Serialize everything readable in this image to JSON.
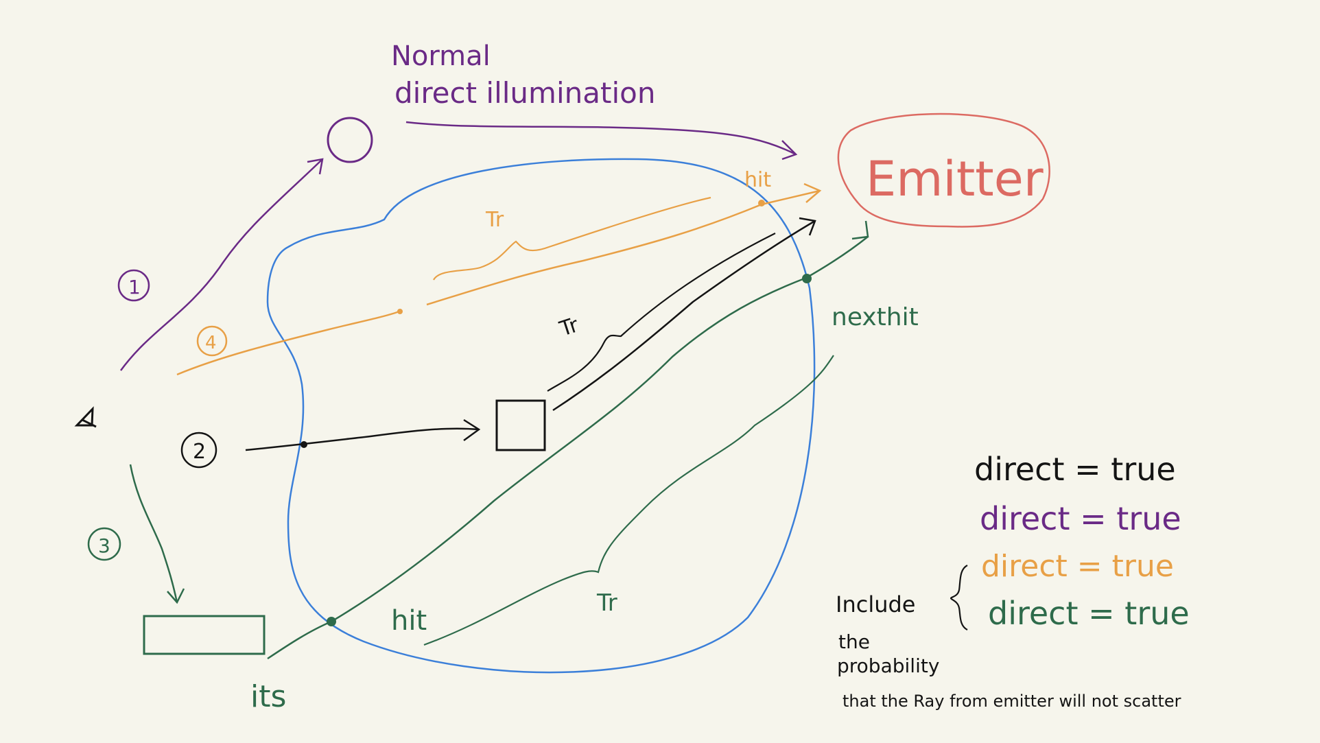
{
  "colors": {
    "background": "#f6f5ec",
    "purple": "#6a2a86",
    "black": "#141414",
    "orange": "#e8a046",
    "green": "#2e6b4b",
    "blue": "#3b7fd9",
    "red": "#dc6a62"
  },
  "labels": {
    "normal": "Normal",
    "direct_illumination": "direct illumination",
    "emitter": "Emitter",
    "hit_top": "hit",
    "tr_orange": "Tr",
    "tr_black": "Tr",
    "nexthit": "nexthit",
    "hit_bottom": "hit",
    "tr_green": "Tr",
    "its": "its",
    "num1": "1",
    "num2": "2",
    "num3": "3",
    "num4": "4"
  },
  "legend": {
    "items": [
      {
        "text": "direct = true",
        "color": "#141414"
      },
      {
        "text": "direct = true",
        "color": "#6a2a86"
      },
      {
        "text": "direct = true",
        "color": "#e8a046"
      },
      {
        "text": "direct = true",
        "color": "#2e6b4b"
      }
    ]
  },
  "notes": {
    "include": "Include",
    "the": "the",
    "probability": "probability",
    "scatter": "that the Ray from emitter will not scatter"
  }
}
